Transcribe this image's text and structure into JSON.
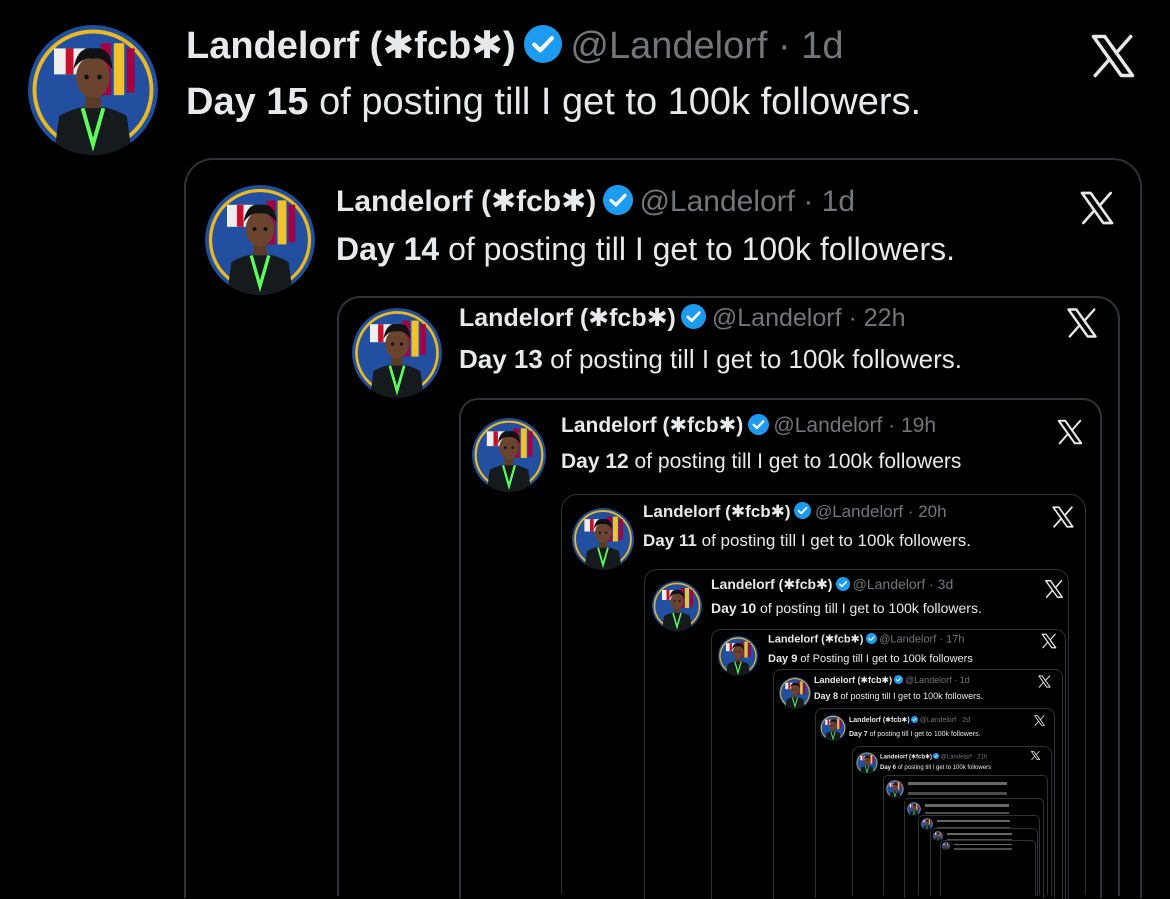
{
  "brand": {
    "logo_icon": "x-logo-icon",
    "verified_color": "#1d9bf0",
    "text_color": "#e7e9ea",
    "muted_color": "#71767b",
    "border_color": "#2f3336"
  },
  "tweets": [
    {
      "name": "Landelorf (✱fcb✱)",
      "handle": "@Landelorf",
      "time": "· 1d",
      "day": "Day 15",
      "rest": " of posting till I get to 100k followers."
    },
    {
      "name": "Landelorf (✱fcb✱)",
      "handle": "@Landelorf",
      "time": "· 1d",
      "day": "Day 14",
      "rest": " of posting till I get to 100k followers."
    },
    {
      "name": "Landelorf (✱fcb✱)",
      "handle": "@Landelorf",
      "time": "· 22h",
      "day": "Day 13",
      "rest": " of posting till I get to 100k followers."
    },
    {
      "name": "Landelorf (✱fcb✱)",
      "handle": "@Landelorf",
      "time": "· 19h",
      "day": "Day 12",
      "rest": " of posting till I get to 100k followers"
    },
    {
      "name": "Landelorf (✱fcb✱)",
      "handle": "@Landelorf",
      "time": "· 20h",
      "day": "Day 11",
      "rest": " of posting till I get to 100k followers."
    },
    {
      "name": "Landelorf (✱fcb✱)",
      "handle": "@Landelorf",
      "time": "· 3d",
      "day": "Day 10",
      "rest": " of posting till I get to 100k followers."
    },
    {
      "name": "Landelorf (✱fcb✱)",
      "handle": "@Landelorf",
      "time": "· 17h",
      "day": "Day 9",
      "rest": " of Posting till I get to 100k followers"
    },
    {
      "name": "Landelorf (✱fcb✱)",
      "handle": "@Landelorf",
      "time": "· 1d",
      "day": "Day 8",
      "rest": " of posting till I get to 100k followers."
    },
    {
      "name": "Landelorf (✱fcb✱)",
      "handle": "@Landelorf",
      "time": "· 2d",
      "day": "Day 7",
      "rest": " of posting till I get to 100k followers."
    },
    {
      "name": "Landelorf (✱fcb✱)",
      "handle": "@Landelorf",
      "time": "· 21h",
      "day": "Day 6",
      "rest": " of posting till I get to 100k followers"
    }
  ]
}
